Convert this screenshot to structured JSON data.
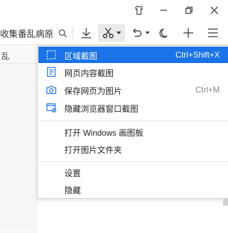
{
  "toolbar": {
    "address_text": "收集番乱病原"
  },
  "left_pane": {
    "tab_label": "乱"
  },
  "menu": {
    "items": [
      {
        "label": "区域截图",
        "shortcut": "Ctrl+Shift+X",
        "icon": "region-select-icon",
        "selected": true
      },
      {
        "label": "网页内容截图",
        "shortcut": "",
        "icon": "document-icon",
        "selected": false
      },
      {
        "label": "保存网页为图片",
        "shortcut": "Ctrl+M",
        "icon": "camera-icon",
        "selected": false
      },
      {
        "label": "隐藏浏览器窗口截图",
        "shortcut": "",
        "icon": "hide-window-icon",
        "selected": false
      }
    ],
    "group2": [
      {
        "label": "打开 Windows 画图板"
      },
      {
        "label": "打开图片文件夹"
      }
    ],
    "group3": [
      {
        "label": "设置"
      },
      {
        "label": "隐藏"
      }
    ]
  },
  "colors": {
    "accent": "#1a73e8",
    "icon": "#555555"
  }
}
